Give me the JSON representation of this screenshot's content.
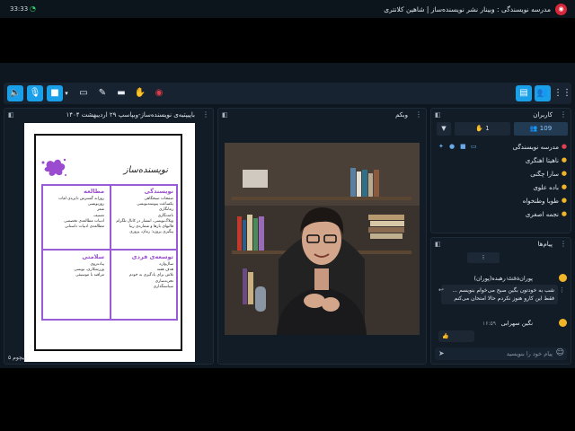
{
  "statusbar": {
    "time": "33:33",
    "meeting_title": "مدرسه نویسندگی : وبینار نشر نویسنده‌ساز | شاهین کلانتری"
  },
  "toolbar": {
    "buttons": [
      "speaker-icon",
      "mic-icon",
      "camera-icon",
      "screen-share-icon",
      "pen-icon",
      "folder-icon",
      "upload-icon",
      "hand-icon",
      "record-icon"
    ],
    "right_buttons": [
      "chat-icon",
      "users-icon",
      "grid-icon"
    ]
  },
  "presentation": {
    "title": "باپیپتیه‌ی نویسنده‌ساز-وبپاسپ ۲۹ اردیبهشت ۱۴۰۴",
    "footer": "پیچوم ۵",
    "brand": "نویسنده‌ساز",
    "cells": {
      "writing": {
        "title": "نویسندگی",
        "items": [
          "صفحات صبحگاهی",
          "یکساعت پیوسته‌نویسی",
          "رمانگاری",
          "نامه‌نگاری",
          "وبلاگ‌نویسی، انتشار در کانال تلگرام",
          "قالبهای بارها و شماره‌ی زیبا",
          "پیگیری پروژه: رمان، پروزی"
        ]
      },
      "study": {
        "title": "مطالعه",
        "items": [
          "روزانه گسترش دایره‌ی لغات",
          "روزنویسی",
          "شعر",
          "تصنیف",
          "ادبیات مطالعه‌ی تخصصی",
          "مطالعه‌ی ادبیات داستانی"
        ]
      },
      "growth": {
        "title": "توسعه‌ی فردی",
        "items": [
          "سال‌واژه",
          "هدف هفته",
          "تلاش برای یادگیری به خودم",
          "تجربه‌سازی",
          "سیاستگذاری"
        ]
      },
      "health": {
        "title": "سلامتی",
        "items": [
          "پیاده‌روی",
          "ورزشکاری، نویسی",
          "مراقبه یا موسیقی"
        ]
      }
    }
  },
  "webcam": {
    "title": "وبکم"
  },
  "participants": {
    "title": "کاربران",
    "count": "109",
    "hands": "1",
    "list": [
      {
        "name": "مدرسه نویسندگی",
        "color": "#e0404f"
      },
      {
        "name": "ناهیتا اهنگری",
        "color": "#f0b429"
      },
      {
        "name": "سارا چگنی",
        "color": "#f0b429"
      },
      {
        "name": "باده علوی",
        "color": "#f0b429"
      },
      {
        "name": "طوبا وطنخواه",
        "color": "#f0b429"
      },
      {
        "name": "نجمه اصغری",
        "color": "#f0b429"
      }
    ]
  },
  "chat": {
    "title": "پیام‌ها",
    "messages": [
      {
        "name": "پوران‌دخت رهبده(پوران)",
        "time": "۱۶:۵۸",
        "text": [
          "شب به خودتون بگین صبح می‌خوام بنویسم ...",
          "فقط این کارو هنوز نکردم حالا امتحان می‌کنم"
        ]
      },
      {
        "name": "نگین سهرابی",
        "time": "۱۶:۵۹",
        "text": [
          "👍"
        ]
      }
    ],
    "input_placeholder": "پیام خود را بنویسید"
  }
}
